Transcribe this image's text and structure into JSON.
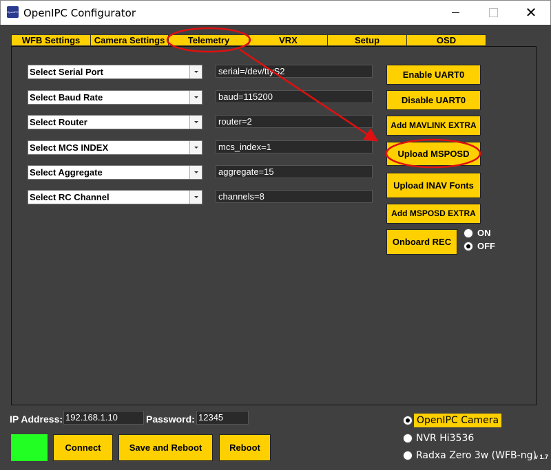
{
  "window": {
    "title": "OpenIPC Configurator",
    "icon_text": "OpenIPC",
    "close_glyph": "✕"
  },
  "tabs": [
    {
      "label": "WFB Settings"
    },
    {
      "label": "Camera Settings"
    },
    {
      "label": "Telemetry"
    },
    {
      "label": "VRX"
    },
    {
      "label": "Setup"
    },
    {
      "label": "OSD"
    }
  ],
  "telemetry": {
    "rows": [
      {
        "select": "Select Serial Port",
        "value": "serial=/dev/ttyS2"
      },
      {
        "select": "Select Baud Rate",
        "value": "baud=115200"
      },
      {
        "select": "Select Router",
        "value": "router=2"
      },
      {
        "select": "Select MCS INDEX",
        "value": "mcs_index=1"
      },
      {
        "select": "Select Aggregate",
        "value": "aggregate=15"
      },
      {
        "select": "Select RC Channel",
        "value": "channels=8"
      }
    ],
    "buttons": {
      "enable_uart0": "Enable UART0",
      "disable_uart0": "Disable UART0",
      "add_mavlink_extra": "Add MAVLINK EXTRA",
      "upload_msposd": "Upload MSPOSD",
      "upload_inav_fonts": "Upload INAV Fonts",
      "add_msposd_extra": "Add MSPOSD EXTRA",
      "onboard_rec": "Onboard REC"
    },
    "onboard_rec_options": [
      {
        "label": "ON",
        "selected": false
      },
      {
        "label": "OFF",
        "selected": true
      }
    ]
  },
  "connection": {
    "ip_label": "IP Address:",
    "ip_value": "192.168.1.10",
    "password_label": "Password:",
    "password_value": "12345",
    "status_color": "#22ff22",
    "connect_label": "Connect",
    "save_reboot_label": "Save and Reboot",
    "reboot_label": "Reboot"
  },
  "device_options": [
    {
      "label": "OpenIPC Camera",
      "selected": true
    },
    {
      "label": "NVR Hi3536",
      "selected": false
    },
    {
      "label": "Radxa Zero 3w (WFB-ng)",
      "selected": false
    }
  ],
  "version": "v 1.7",
  "colors": {
    "accent_yellow": "#ffd000",
    "background": "#404040",
    "annotation_red": "#e01010"
  }
}
